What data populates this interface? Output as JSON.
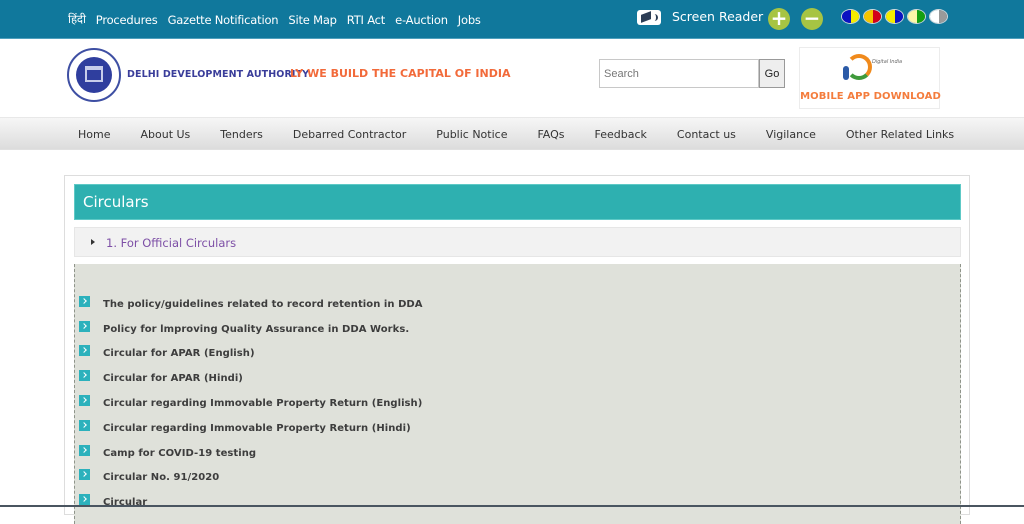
{
  "topbar": {
    "links": [
      "हिंदी",
      "Procedures",
      "Gazette Notification",
      "Site Map",
      "RTI Act",
      "e-Auction",
      "Jobs"
    ],
    "screen_reader_label": "Screen Reader",
    "zoom_in": "+",
    "zoom_out": "−",
    "contrast_themes": [
      {
        "left": "#0b12c2",
        "right": "#f5ec00"
      },
      {
        "left": "#f6c500",
        "right": "#d3001a"
      },
      {
        "left": "#f5ec00",
        "right": "#0b12c2"
      },
      {
        "left": "#fdf7a8",
        "right": "#16a010"
      },
      {
        "left": "#ffffff",
        "right": "#9a9a9a"
      }
    ]
  },
  "header": {
    "org_name": "DELHI DEVELOPMENT AUTHORITY",
    "tagline": "LY WE BUILD THE CAPITAL OF INDIA",
    "search_placeholder": "Search",
    "search_value": "",
    "go_label": "Go",
    "digital_india_text": "Digital India",
    "app_download_label": "MOBILE APP DOWNLOAD"
  },
  "nav": {
    "items": [
      "Home",
      "About Us",
      "Tenders",
      "Debarred Contractor",
      "Public Notice",
      "FAQs",
      "Feedback",
      "Contact us",
      "Vigilance",
      "Other Related Links"
    ]
  },
  "content": {
    "title": "Circulars",
    "section_label": "1. For Official Circulars",
    "items": [
      "The policy/guidelines related to record retention in DDA",
      "Policy for lmproving Quality Assurance in DDA Works.",
      "Circular for APAR (English)",
      "Circular for APAR (Hindi)",
      "Circular regarding Immovable Property Return (English)",
      "Circular regarding Immovable Property Return (Hindi)",
      "Camp for COVID-19 testing",
      "Circular No. 91/2020",
      "Circular"
    ]
  },
  "colors": {
    "topbar": "#10789c",
    "accent_teal": "#2eb0b0",
    "tagline_orange": "#f26a3a",
    "link_purple": "#7d4fa6"
  }
}
